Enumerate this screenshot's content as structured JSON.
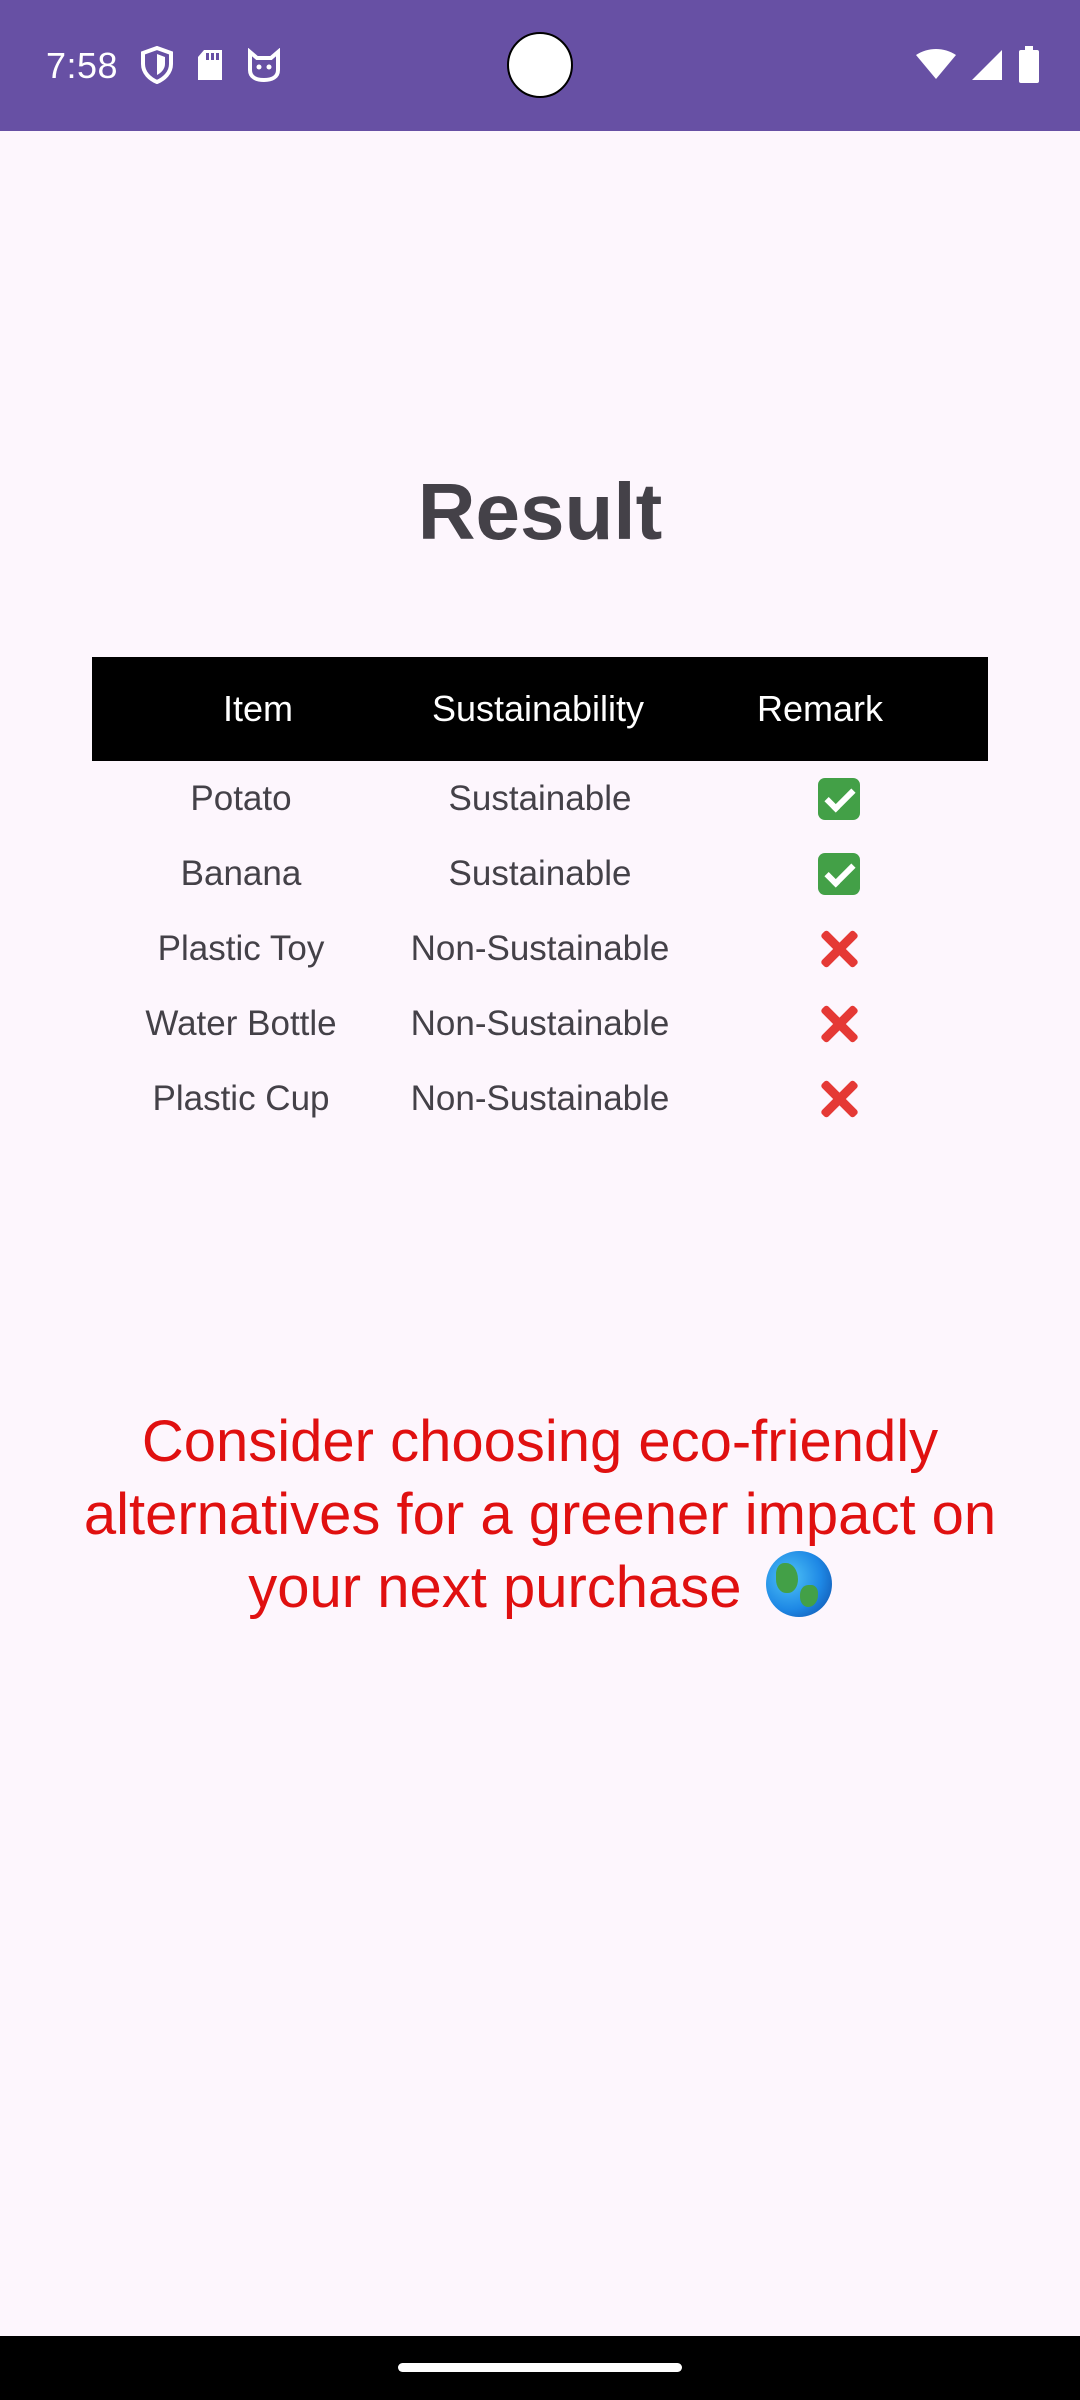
{
  "status_bar": {
    "time": "7:58",
    "icons_left": [
      "shield-icon",
      "sd-card-icon",
      "cat-face-icon"
    ],
    "icons_right": [
      "wifi-icon",
      "signal-icon",
      "battery-icon"
    ],
    "background_color": "#6750a4"
  },
  "page": {
    "title": "Result"
  },
  "table": {
    "headers": {
      "item": "Item",
      "sustainability": "Sustainability",
      "remark": "Remark"
    },
    "rows": [
      {
        "item": "Potato",
        "sustainability": "Sustainable",
        "remark": "check-mark-icon"
      },
      {
        "item": "Banana",
        "sustainability": "Sustainable",
        "remark": "check-mark-icon"
      },
      {
        "item": "Plastic Toy",
        "sustainability": "Non-Sustainable",
        "remark": "cross-mark-icon"
      },
      {
        "item": "Water Bottle",
        "sustainability": "Non-Sustainable",
        "remark": "cross-mark-icon"
      },
      {
        "item": "Plastic Cup",
        "sustainability": "Non-Sustainable",
        "remark": "cross-mark-icon"
      }
    ]
  },
  "message": {
    "text": "Consider choosing eco-friendly alternatives for a greener impact on your next purchase",
    "icon": "globe-icon",
    "color": "#e01010"
  }
}
